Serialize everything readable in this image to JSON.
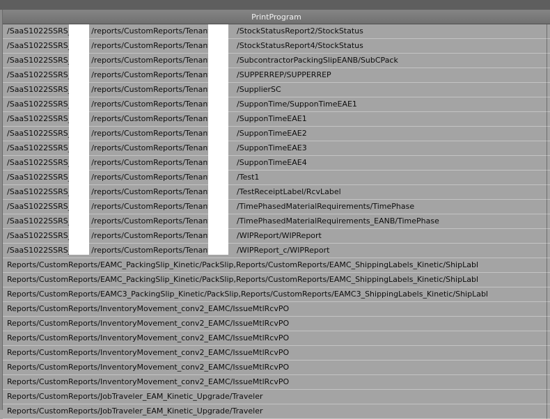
{
  "grid": {
    "column_header": "PrintProgram",
    "rows": [
      "/SaaS1022SSRS_        /reports/CustomReports/Tenants/        /StockStatusReport2/StockStatus",
      "/SaaS1022SSRS_        /reports/CustomReports/Tenants/        /StockStatusReport4/StockStatus",
      "/SaaS1022SSRS_        /reports/CustomReports/Tenants/        /SubcontractorPackingSlipEANB/SubCPack",
      "/SaaS1022SSRS_        /reports/CustomReports/Tenants/        /SUPPERREP/SUPPERREP",
      "/SaaS1022SSRS_        /reports/CustomReports/Tenants/        /SupplierSC",
      "/SaaS1022SSRS_        /reports/CustomReports/Tenants/        /SupponTime/SupponTimeEAE1",
      "/SaaS1022SSRS_        /reports/CustomReports/Tenants/        /SupponTimeEAE1",
      "/SaaS1022SSRS_        /reports/CustomReports/Tenants/        /SupponTimeEAE2",
      "/SaaS1022SSRS_        /reports/CustomReports/Tenants/        /SupponTimeEAE3",
      "/SaaS1022SSRS_        /reports/CustomReports/Tenants/        /SupponTimeEAE4",
      "/SaaS1022SSRS_        /reports/CustomReports/Tenants/        /Test1",
      "/SaaS1022SSRS_        /reports/CustomReports/Tenants/        /TestReceiptLabel/RcvLabel",
      "/SaaS1022SSRS_        /reports/CustomReports/Tenants/        /TimePhasedMaterialRequirements/TimePhase",
      "/SaaS1022SSRS_        /reports/CustomReports/Tenants/        /TimePhasedMaterialRequirements_EANB/TimePhase",
      "/SaaS1022SSRS_        /reports/CustomReports/Tenants/        /WIPReport/WIPReport",
      "/SaaS1022SSRS_        /reports/CustomReports/Tenants/        /WIPReport_c/WIPReport",
      "Reports/CustomReports/EAMC_PackingSlip_Kinetic/PackSlip,Reports/CustomReports/EAMC_ShippingLabels_Kinetic/ShipLabl",
      "Reports/CustomReports/EAMC_PackingSlip_Kinetic/PackSlip,Reports/CustomReports/EAMC_ShippingLabels_Kinetic/ShipLabl",
      "Reports/CustomReports/EAMC3_PackingSlip_Kinetic/PackSlip,Reports/CustomReports/EAMC3_ShippingLabels_Kinetic/ShipLabl",
      "Reports/CustomReports/InventoryMovement_conv2_EAMC/IssueMtlRcvPO",
      "Reports/CustomReports/InventoryMovement_conv2_EAMC/IssueMtlRcvPO",
      "Reports/CustomReports/InventoryMovement_conv2_EAMC/IssueMtlRcvPO",
      "Reports/CustomReports/InventoryMovement_conv2_EAMC/IssueMtlRcvPO",
      "Reports/CustomReports/InventoryMovement_conv2_EAMC/IssueMtlRcvPO",
      "Reports/CustomReports/InventoryMovement_conv2_EAMC/IssueMtlRcvPO",
      "Reports/CustomReports/JobTraveler_EAM_Kinetic_Upgrade/Traveler",
      "Reports/CustomReports/JobTraveler_EAM_Kinetic_Upgrade/Traveler"
    ]
  },
  "colors": {
    "row_bg": "#a4a4a4",
    "header_bg": "#7a7a7a",
    "top_bar": "#5e5e5e",
    "mask": "#ffffff"
  }
}
